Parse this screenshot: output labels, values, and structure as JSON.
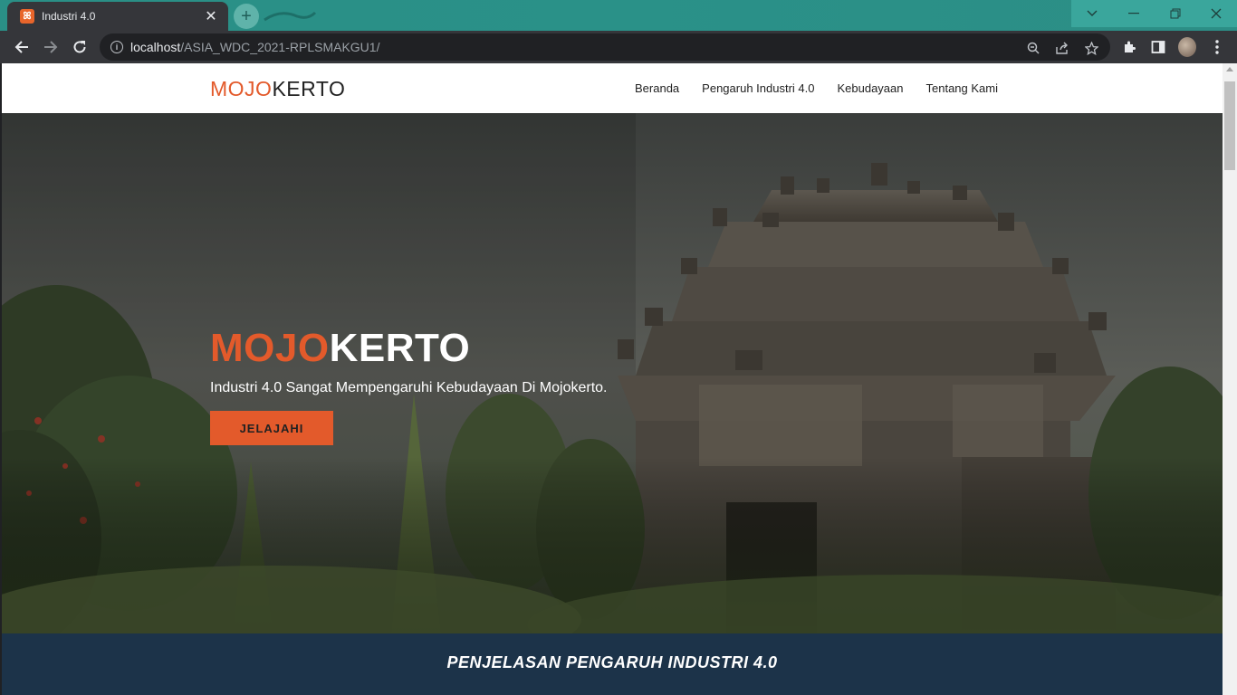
{
  "browser": {
    "tab_title": "Industri 4.0",
    "tab_close": "✕",
    "new_tab": "+",
    "url_host": "localhost",
    "url_path": "/ASIA_WDC_2021-RPLSMAKGU1/"
  },
  "site": {
    "logo_part1": "MOJO",
    "logo_part2": "KERTO",
    "nav": [
      "Beranda",
      "Pengaruh Industri 4.0",
      "Kebudayaan",
      "Tentang Kami"
    ],
    "hero": {
      "title_part1": "MOJO",
      "title_part2": "KERTO",
      "subtitle": "Industri 4.0 Sangat Mempengaruhi Kebudayaan Di Mojokerto.",
      "button": "JELAJAHI"
    },
    "section_title": "PENJELASAN PENGARUH INDUSTRI 4.0"
  },
  "colors": {
    "accent": "#e35a2b",
    "section_bg": "#1c3349",
    "titlebar": "#2a8f86"
  },
  "icons": [
    "back-icon",
    "forward-icon",
    "reload-icon",
    "info-icon",
    "zoom-icon",
    "share-icon",
    "star-icon",
    "extensions-icon",
    "sidepanel-icon",
    "menu-icon"
  ]
}
